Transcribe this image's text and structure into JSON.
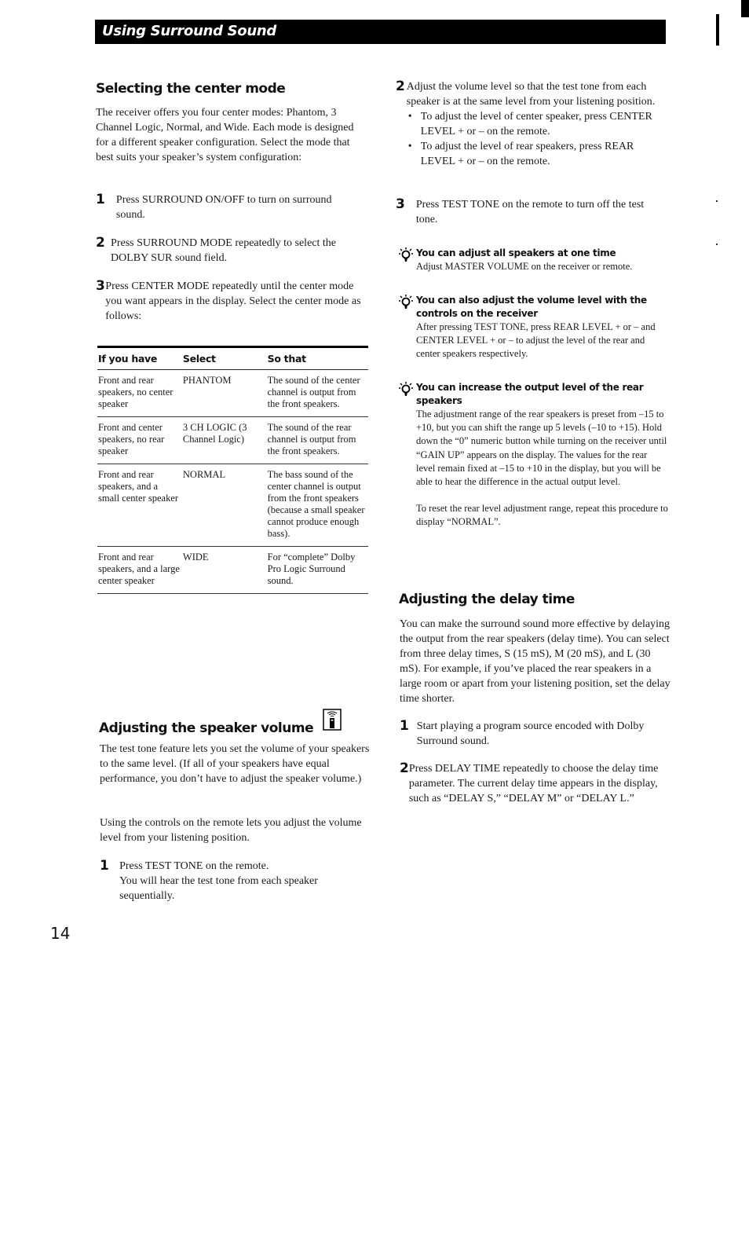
{
  "header": {
    "title": "Using Surround Sound"
  },
  "center_mode": {
    "heading": "Selecting the center mode",
    "intro": "The receiver offers you four center modes: Phantom, 3 Channel Logic, Normal, and Wide. Each mode is designed for a different speaker configuration.  Select the mode that best suits your speaker’s system configuration:",
    "steps": [
      {
        "num": "1",
        "text": "Press SURROUND ON/OFF to turn on surround sound."
      },
      {
        "num": "2",
        "text": "Press SURROUND MODE repeatedly to select the DOLBY SUR sound field."
      },
      {
        "num": "3",
        "text": "Press CENTER MODE repeatedly until the center mode you want appears in the display.  Select the center mode as follows:"
      }
    ],
    "table": {
      "headers": [
        "If you have",
        "Select",
        "So that"
      ],
      "rows": [
        [
          "Front and rear speakers, no center speaker",
          "PHANTOM",
          "The sound of the center channel is output from the front speakers."
        ],
        [
          "Front and center speakers, no rear speaker",
          "3 CH LOGIC (3 Channel Logic)",
          "The sound of the rear channel is output from the front speakers."
        ],
        [
          "Front and rear speakers, and a small center speaker",
          "NORMAL",
          "The bass sound of the center channel is output from the front speakers (because a small speaker cannot produce enough bass)."
        ],
        [
          "Front and rear speakers, and a large center speaker",
          "WIDE",
          "For “complete” Dolby Pro Logic Surround sound."
        ]
      ]
    }
  },
  "speaker_volume": {
    "heading": "Adjusting the speaker volume",
    "heading_icon": "remote-control-icon",
    "para1": "The test tone feature lets you set the volume of your speakers to the same level. (If all of your speakers have equal performance, you don’t have to adjust the speaker volume.)",
    "para2": "Using the controls on the remote lets you adjust the volume level from your listening position.",
    "step1": {
      "num": "1",
      "text": "Press TEST TONE on the remote.",
      "subtext": "You will hear the test tone from each speaker sequentially."
    },
    "step2": {
      "num": "2",
      "text": "Adjust the volume level so that the test tone from each speaker is at the same level from your listening position.",
      "bullets": [
        "To adjust the level of center speaker, press CENTER LEVEL + or – on the remote.",
        "To adjust the level of rear speakers, press REAR LEVEL + or – on the remote."
      ]
    },
    "step3": {
      "num": "3",
      "text": "Press TEST TONE on the remote to turn off the test tone."
    }
  },
  "tips": [
    {
      "icon": "lightbulb-tip-icon",
      "title": "You can adjust all speakers at one time",
      "body": "Adjust MASTER VOLUME on the receiver or remote."
    },
    {
      "icon": "lightbulb-tip-icon",
      "title": "You can also adjust the volume level with the controls on the receiver",
      "body": "After pressing TEST TONE, press REAR LEVEL + or – and CENTER LEVEL + or – to adjust the level of the rear and center speakers respectively."
    },
    {
      "icon": "lightbulb-tip-icon",
      "title": "You can increase the output level of the rear speakers",
      "body": "The adjustment range of the rear speakers is preset from –15 to +10, but you can shift the range up 5 levels (–10 to +15).  Hold down the “0” numeric button while turning on the receiver until “GAIN UP” appears on the display. The values for the rear level remain fixed at –15 to +10 in the display, but you will be able to hear the difference in the actual output level.",
      "body2": "To reset the rear level adjustment range, repeat this procedure to display “NORMAL”."
    }
  ],
  "delay_time": {
    "heading": "Adjusting the delay time",
    "intro": "You can make the surround sound more effective by delaying the output from the rear speakers (delay time). You can select from three delay times, S (15 mS), M (20 mS), and L (30 mS). For example, if you’ve placed the rear speakers in a large room or apart from your listening position, set the delay time shorter.",
    "steps": [
      {
        "num": "1",
        "text": "Start playing a program source encoded with Dolby Surround sound."
      },
      {
        "num": "2",
        "text": "Press DELAY TIME repeatedly to choose the delay time parameter.  The current delay time appears in the display, such as “DELAY S,” “DELAY M” or “DELAY L.”"
      }
    ]
  },
  "page_number": "14"
}
